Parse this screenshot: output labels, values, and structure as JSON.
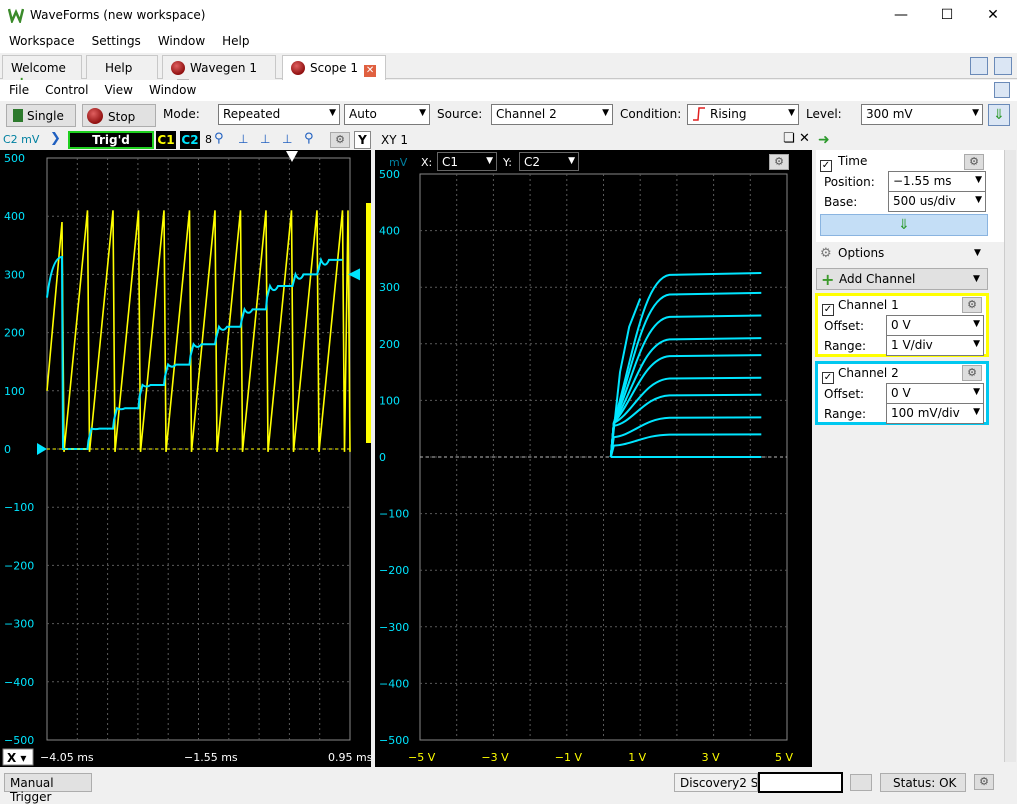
{
  "window": {
    "title": "WaveForms (new workspace)"
  },
  "menu": [
    "Workspace",
    "Settings",
    "Window",
    "Help"
  ],
  "tabs": [
    {
      "label": "Welcome"
    },
    {
      "label": "Help"
    },
    {
      "label": "Wavegen 1"
    },
    {
      "label": "Scope 1"
    }
  ],
  "scope_menu": [
    "File",
    "Control",
    "View",
    "Window"
  ],
  "toolbar": {
    "single_label": "Single",
    "stop_label": "Stop",
    "mode_label": "Mode:",
    "mode_value": "Repeated",
    "auto_value": "Auto",
    "source_label": "Source:",
    "source_value": "Channel 2",
    "condition_label": "Condition:",
    "condition_value": "Rising",
    "level_label": "Level:",
    "level_value": "300 mV"
  },
  "left_plot": {
    "channel_unit": "C2 mV",
    "trig_status": "Trig'd",
    "c1": "C1",
    "c2": "C2",
    "digit": "8",
    "y_button": "Y",
    "y_ticks": [
      "500",
      "400",
      "300",
      "200",
      "100",
      "0",
      "−100",
      "−200",
      "−300",
      "−400",
      "−500"
    ],
    "x_axis_label": "X",
    "x_ticks": [
      "−4.05 ms",
      "−1.55 ms",
      "0.95 ms"
    ]
  },
  "xy_plot": {
    "title": "XY 1",
    "unit": "mV",
    "x_label": "X:",
    "x_value": "C1",
    "y_label": "Y:",
    "y_value": "C2",
    "y_ticks": [
      "500",
      "400",
      "300",
      "200",
      "100",
      "0",
      "−100",
      "−200",
      "−300",
      "−400",
      "−500"
    ],
    "x_ticks": [
      "−5 V",
      "−3 V",
      "−1 V",
      "1 V",
      "3 V",
      "5 V"
    ]
  },
  "side": {
    "time_label": "Time",
    "position_label": "Position:",
    "position_value": "−1.55 ms",
    "base_label": "Base:",
    "base_value": "500 us/div",
    "options_label": "Options",
    "add_channel_label": "Add Channel",
    "ch1": {
      "name": "Channel 1",
      "offset_label": "Offset:",
      "offset_value": "0 V",
      "range_label": "Range:",
      "range_value": "1 V/div"
    },
    "ch2": {
      "name": "Channel 2",
      "offset_label": "Offset:",
      "offset_value": "0 V",
      "range_label": "Range:",
      "range_value": "100 mV/div"
    }
  },
  "status": {
    "manual_trigger": "Manual Trigger",
    "device": "Discovery2 SN",
    "status": "Status: OK"
  },
  "colors": {
    "ch1": "#ffff00",
    "ch2": "#00e5ff",
    "grid": "#5a5a5a"
  },
  "chart_data": [
    {
      "type": "line",
      "title": "",
      "xlabel": "",
      "ylabel": "C2 mV",
      "xlim": [
        -4.05,
        0.95
      ],
      "ylim": [
        -500,
        500
      ],
      "series": [
        {
          "name": "C1",
          "values": "sawtooth 0 to ~4 V repeating"
        },
        {
          "name": "C2",
          "values": "staircase steps 0,30,70,110,140,180,215,240,280,310,325 mV"
        }
      ]
    },
    {
      "type": "line",
      "title": "",
      "xlabel": "X: C1",
      "ylabel": "Y: C2 (mV)",
      "xlim": [
        -5,
        5
      ],
      "ylim": [
        -500,
        500
      ],
      "series": [
        {
          "name": "C2 vs C1",
          "steps_mV": [
            0,
            40,
            70,
            110,
            140,
            180,
            210,
            250,
            290,
            325
          ]
        }
      ]
    }
  ]
}
